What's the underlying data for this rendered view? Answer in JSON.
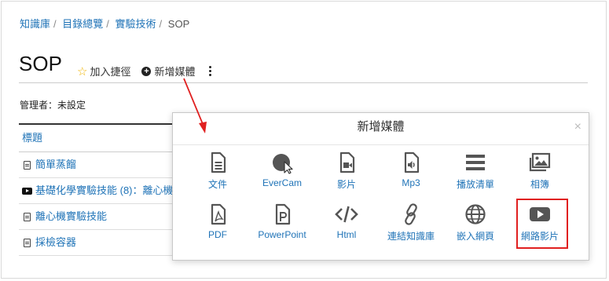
{
  "breadcrumb": [
    {
      "label": "知識庫"
    },
    {
      "label": "目錄總覽"
    },
    {
      "label": "實驗技術"
    }
  ],
  "breadcrumb_current": "SOP",
  "page": {
    "title": "SOP",
    "bookmark_label": "加入捷徑",
    "add_media_label": "新增媒體"
  },
  "manager_text": "管理者：未設定",
  "table": {
    "header": "標題",
    "rows": [
      {
        "icon": "file-icon",
        "label": "簡單蒸餾"
      },
      {
        "icon": "youtube-icon",
        "label": "基礎化學實驗技能 (8)：離心機"
      },
      {
        "icon": "pdf-icon",
        "label": "離心機實驗技能"
      },
      {
        "icon": "pdf-icon",
        "label": "採檢容器"
      }
    ]
  },
  "modal": {
    "title": "新增媒體",
    "close_symbol": "×",
    "items": [
      {
        "icon": "document-icon",
        "label": "文件"
      },
      {
        "icon": "evercam-icon",
        "label": "EverCam"
      },
      {
        "icon": "video-file-icon",
        "label": "影片"
      },
      {
        "icon": "audio-file-icon",
        "label": "Mp3"
      },
      {
        "icon": "playlist-icon",
        "label": "播放清單"
      },
      {
        "icon": "album-icon",
        "label": "相簿"
      },
      {
        "icon": "pdf-icon",
        "label": "PDF"
      },
      {
        "icon": "powerpoint-icon",
        "label": "PowerPoint"
      },
      {
        "icon": "code-icon",
        "label": "Html"
      },
      {
        "icon": "link-icon",
        "label": "連結知識庫"
      },
      {
        "icon": "globe-icon",
        "label": "嵌入網頁"
      },
      {
        "icon": "youtube-icon",
        "label": "網路影片"
      }
    ]
  },
  "colors": {
    "link": "#1f73b7",
    "highlight": "#e02020",
    "star": "#f0b400",
    "icon": "#555555"
  }
}
